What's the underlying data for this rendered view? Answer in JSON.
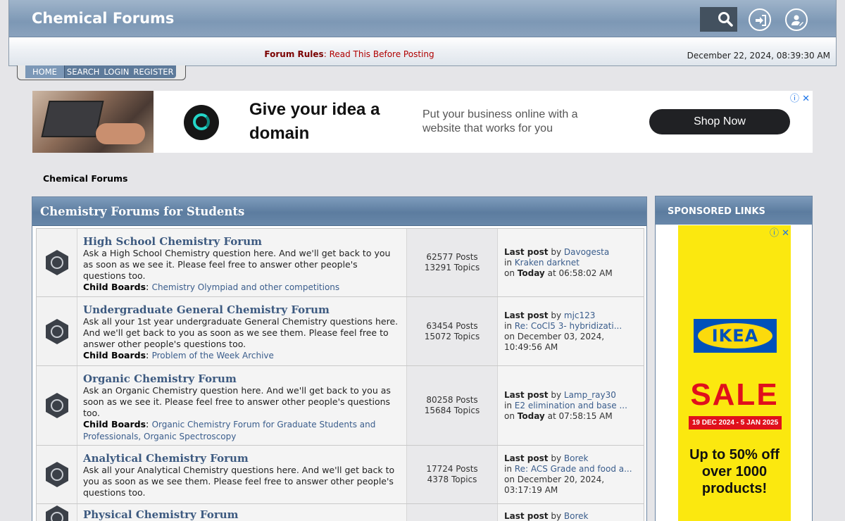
{
  "header": {
    "site_title": "Chemical Forums",
    "rules_label": "Forum Rules",
    "rules_link": "Read This Before Posting",
    "datetime": "December 22, 2024, 08:39:30 AM",
    "icons": [
      "search-icon",
      "login-icon",
      "register-icon"
    ]
  },
  "menu": {
    "home": "HOME",
    "search": "SEARCH",
    "login": "LOGIN",
    "register": "REGISTER"
  },
  "banner_ad": {
    "headline": "Give your idea a domain",
    "copy": "Put your business online with a website that works for you",
    "cta": "Shop Now",
    "badge": "ⓘ ✕"
  },
  "breadcrumb": "Chemical Forums",
  "board": {
    "title": "Chemistry Forums for Students",
    "forums": [
      {
        "title": "High School Chemistry Forum",
        "description": "Ask a High School Chemistry question here. And we'll get back to you as soon as we see it. Please feel free to answer other people's questions too.",
        "child_label": "Child Boards",
        "children": "Chemistry Olympiad and other competitions",
        "posts": "62577 Posts",
        "topics": "13291 Topics",
        "last_label": "Last post",
        "by": "by",
        "author": "Davogesta",
        "in": "in",
        "topic": "Kraken darknet",
        "on": "on",
        "date_bold": "Today",
        "date": "at 06:58:02 AM"
      },
      {
        "title": "Undergraduate General Chemistry Forum",
        "description": "Ask all your 1st year undergraduate General Chemistry questions here. And we'll get back to you as soon as we see them. Please feel free to answer other people's questions too.",
        "child_label": "Child Boards",
        "children": "Problem of the Week Archive",
        "posts": "63454 Posts",
        "topics": "15072 Topics",
        "last_label": "Last post",
        "by": "by",
        "author": "mjc123",
        "in": "in",
        "topic": "Re: CoCl5 3- hybridizati...",
        "on": "on",
        "date_bold": "",
        "date": "December 03, 2024, 10:49:56 AM"
      },
      {
        "title": "Organic Chemistry Forum",
        "description": "Ask an Organic Chemistry question here. And we'll get back to you as soon as we see it. Please feel free to answer other people's questions too.",
        "child_label": "Child Boards",
        "children": "Organic Chemistry Forum for Graduate Students and Professionals, Organic Spectroscopy",
        "posts": "80258 Posts",
        "topics": "15684 Topics",
        "last_label": "Last post",
        "by": "by",
        "author": "Lamp_ray30",
        "in": "in",
        "topic": "E2 elimination and base ...",
        "on": "on",
        "date_bold": "Today",
        "date": "at 07:58:15 AM"
      },
      {
        "title": "Analytical Chemistry Forum",
        "description": "Ask all your Analytical Chemistry questions here. And we'll get back to you as soon as we see them. Please feel free to answer other people's questions too.",
        "child_label": "",
        "children": "",
        "posts": "17724 Posts",
        "topics": "4378 Topics",
        "last_label": "Last post",
        "by": "by",
        "author": "Borek",
        "in": "in",
        "topic": "Re: ACS Grade and food a...",
        "on": "on",
        "date_bold": "",
        "date": "December 20, 2024, 03:17:19 AM"
      },
      {
        "title": "Physical Chemistry Forum",
        "description": "",
        "child_label": "",
        "children": "",
        "posts": "",
        "topics": "",
        "last_label": "Last post",
        "by": "by",
        "author": "Borek",
        "in": "",
        "topic": "",
        "on": "",
        "date_bold": "",
        "date": ""
      }
    ]
  },
  "sidebar": {
    "title": "SPONSORED LINKS",
    "ad": {
      "badge": "ⓘ ✕",
      "brand": "IKEA",
      "sale": "SALE",
      "dates": "19 DEC 2024 - 5 JAN 2025",
      "offer": "Up to 50% off over 1000 products!"
    }
  },
  "colors": {
    "header_blue": "#7d98b5",
    "link_blue": "#3a5d8c",
    "rules_red": "#b00000",
    "ikea_yellow": "#fbe80f",
    "ikea_blue": "#0051ba",
    "sale_red": "#e0101c"
  }
}
